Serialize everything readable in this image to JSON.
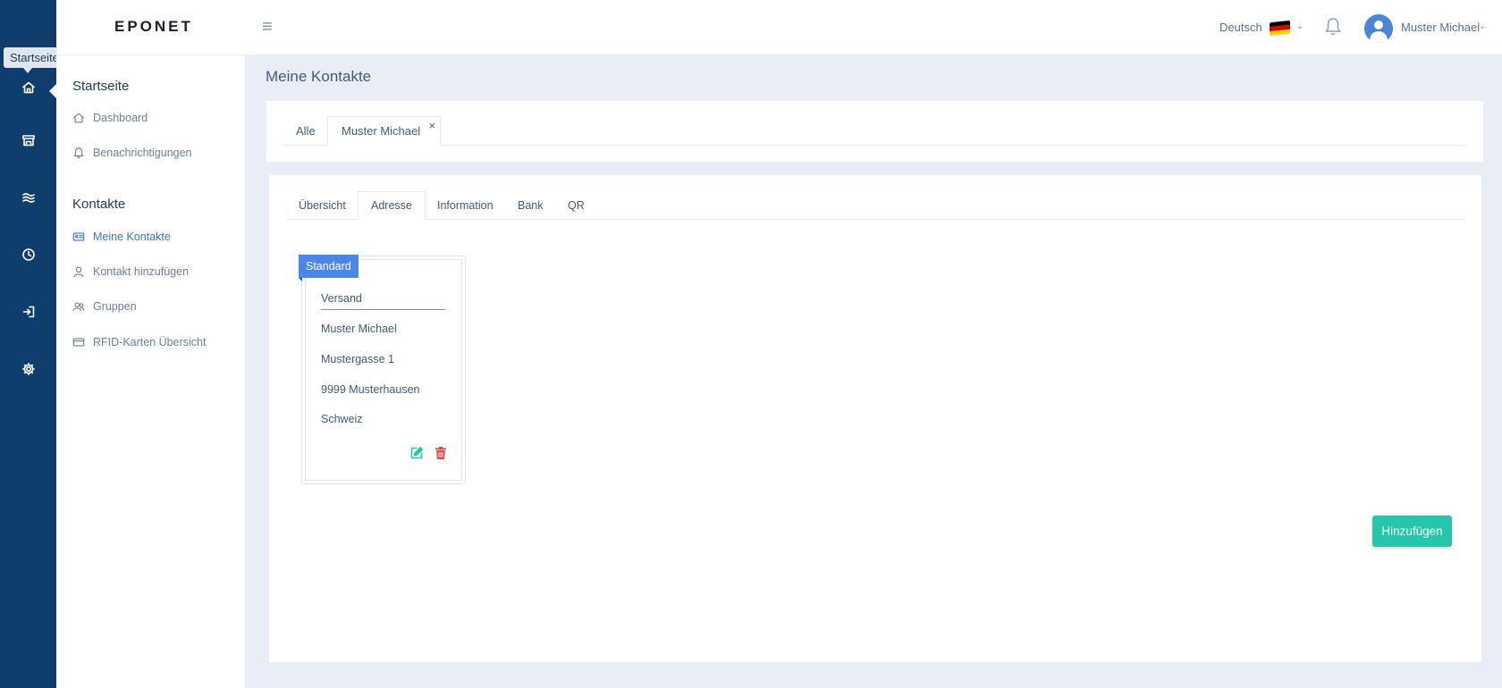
{
  "app": {
    "logo": "EPONET"
  },
  "rail": {
    "tooltip": "Startseite",
    "icons": [
      "home-icon",
      "store-icon",
      "waves-icon",
      "clock-icon",
      "login-icon",
      "gear-icon"
    ]
  },
  "header": {
    "language": "Deutsch",
    "flag_colors": [
      "#000000",
      "#dd0000",
      "#ffce00"
    ],
    "user_name": "Muster Michael"
  },
  "sidebar": {
    "sections": [
      {
        "title": "Startseite",
        "items": [
          {
            "label": "Dashboard",
            "icon": "home-icon"
          },
          {
            "label": "Benachrichtigungen",
            "icon": "bell-icon"
          }
        ]
      },
      {
        "title": "Kontakte",
        "items": [
          {
            "label": "Meine Kontakte",
            "icon": "contact-card-icon",
            "active": true
          },
          {
            "label": "Kontakt hinzufügen",
            "icon": "user-icon"
          },
          {
            "label": "Gruppen",
            "icon": "group-icon"
          },
          {
            "label": "RFID-Karten Übersicht",
            "icon": "card-icon"
          }
        ]
      }
    ]
  },
  "main": {
    "title": "Meine Kontakte",
    "contact_tabs": [
      {
        "label": "Alle"
      },
      {
        "label": "Muster Michael",
        "active": true,
        "closable": true,
        "close": "×"
      }
    ],
    "detail_tabs": [
      {
        "label": "Übersicht"
      },
      {
        "label": "Adresse",
        "active": true
      },
      {
        "label": "Information"
      },
      {
        "label": "Bank"
      },
      {
        "label": "QR"
      }
    ],
    "address_card": {
      "badge": "Standard",
      "type": "Versand",
      "lines": [
        "Muster Michael",
        "Mustergasse 1",
        "9999 Musterhausen",
        "Schweiz"
      ],
      "edit_color": "#26c6aa",
      "delete_color": "#e0474c"
    },
    "add_button": "Hinzufügen"
  },
  "colors": {
    "rail": "#0f3e6d",
    "accent": "#4a86e8",
    "primary_button": "#26c6aa"
  }
}
